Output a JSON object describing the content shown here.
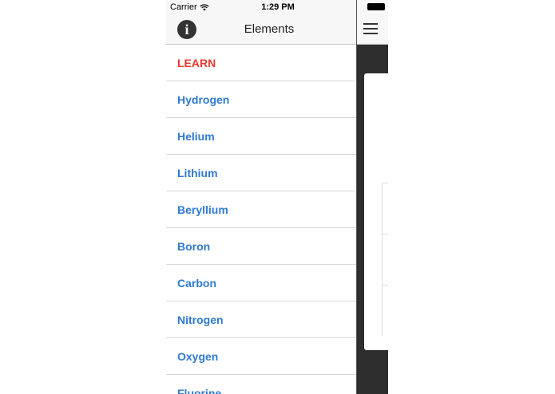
{
  "status_bar": {
    "carrier": "Carrier",
    "time": "1:29 PM",
    "wifi_icon": "wifi-icon",
    "battery_icon": "battery-icon"
  },
  "nav": {
    "title": "Elements",
    "info_icon": "info-icon",
    "menu_icon": "hamburger-icon"
  },
  "menu": {
    "header": "LEARN",
    "items": [
      "Hydrogen",
      "Helium",
      "Lithium",
      "Beryllium",
      "Boron",
      "Carbon",
      "Nitrogen",
      "Oxygen",
      "Fluorine"
    ]
  },
  "colors": {
    "header_red": "#e8392f",
    "link_blue": "#2f7ad0",
    "dark_bg": "#2e2e2e"
  }
}
